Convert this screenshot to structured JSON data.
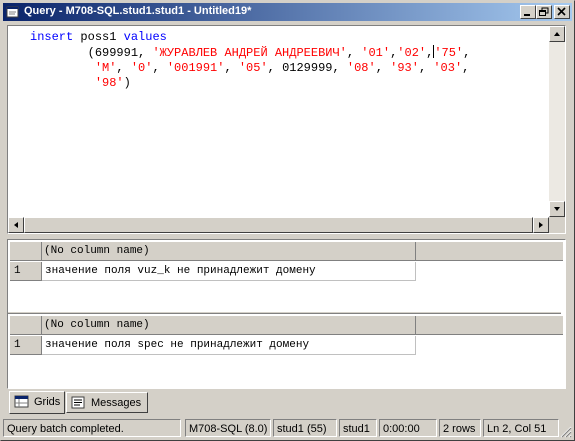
{
  "window": {
    "title": "Query - M708-SQL.stud1.stud1 - Untitled19*"
  },
  "editor": {
    "line1_kw": "insert",
    "line1_rest": " poss1 ",
    "line1_kw2": "values",
    "line2_indent": "        (",
    "line2_n1": "699991",
    "line2_s1": "'ЖУРАВЛЕВ АНДРЕЙ АНДРЕЕВИЧ'",
    "line2_s2": "'01'",
    "line2_s3": "'02'",
    "line2_s4": "'75'",
    "line3_indent": "         ",
    "line3_s1": "'M'",
    "line3_s2": "'0'",
    "line3_s3": "'001991'",
    "line3_s4": "'05'",
    "line3_n1": "0129999",
    "line3_s5": "'08'",
    "line3_s6": "'93'",
    "line3_s7": "'03'",
    "line4_indent": "         ",
    "line4_s1": "'98'",
    "line4_close": ")"
  },
  "results": {
    "grid1": {
      "header": "(No column name)",
      "row_number": "1",
      "value": "значение поля vuz_k не принадлежит домену"
    },
    "grid2": {
      "header": "(No column name)",
      "row_number": "1",
      "value": "значение поля spec не принадлежит домену"
    }
  },
  "tabs": {
    "grids": "Grids",
    "messages": "Messages"
  },
  "statusbar": {
    "message": "Query batch completed.",
    "server": "M708-SQL (8.0)",
    "user": "stud1 (55)",
    "database": "stud1",
    "elapsed": "0:00:00",
    "rows": "2 rows",
    "position": "Ln 2, Col 51"
  },
  "colors": {
    "keyword": "#0000ff",
    "string": "#ff0000",
    "titlebar_start": "#0a246a",
    "titlebar_end": "#a6caf0"
  },
  "icons": {
    "title": "query-window-icon",
    "minimize": "minimize-icon",
    "restore": "restore-icon",
    "close": "close-icon",
    "grids_tab": "grid-icon",
    "messages_tab": "messages-icon"
  }
}
